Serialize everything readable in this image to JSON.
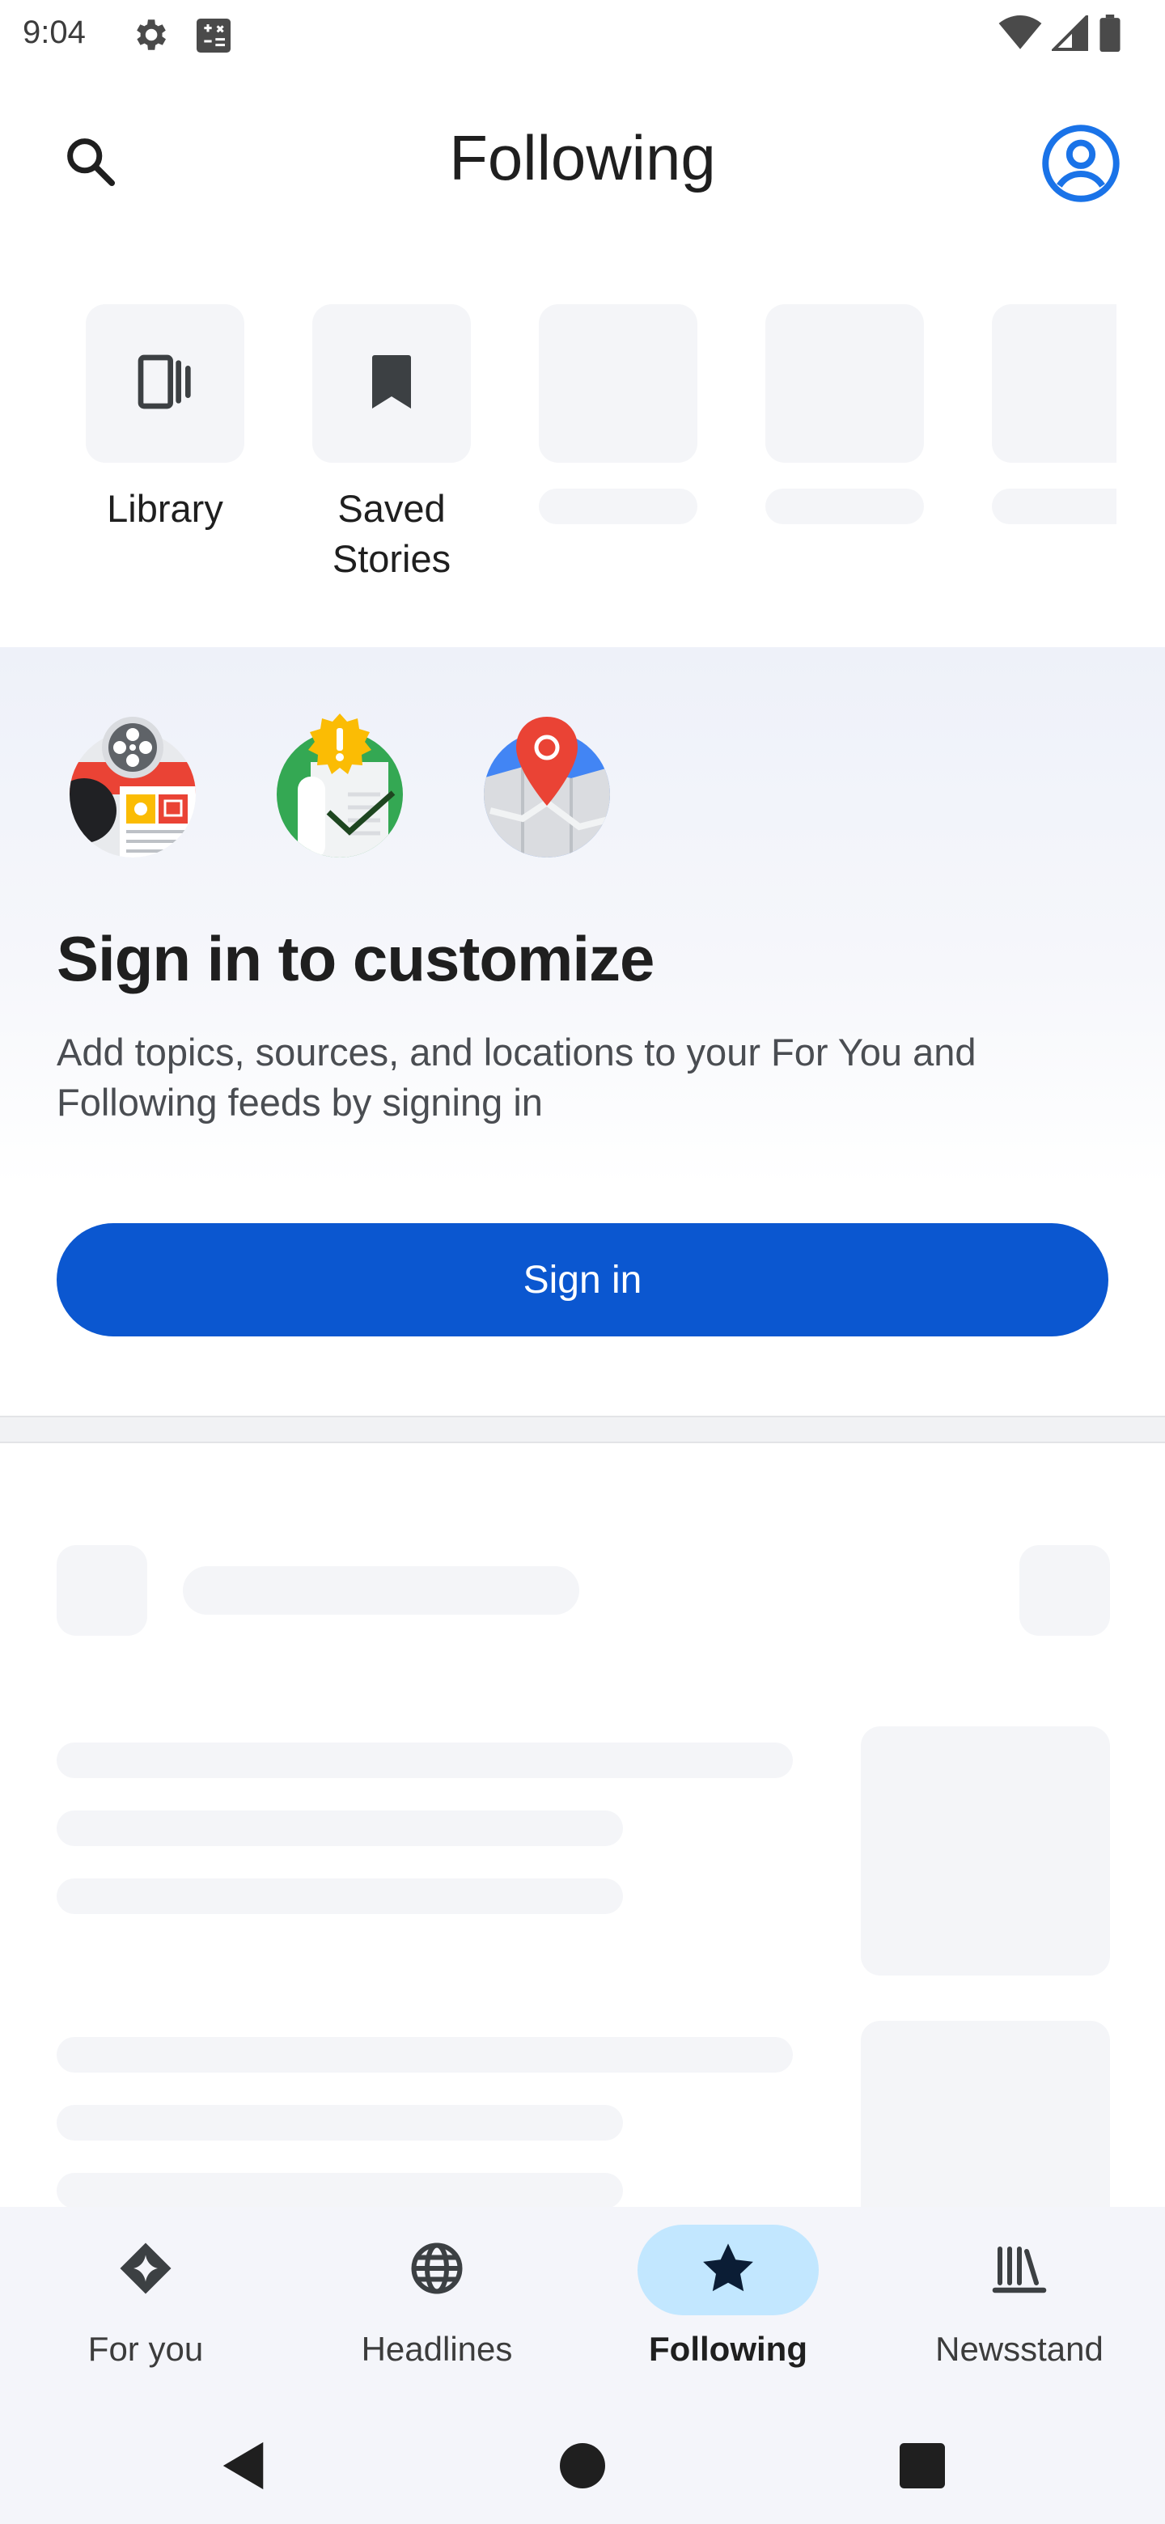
{
  "status_bar": {
    "time": "9:04",
    "icons": [
      "gear-icon",
      "clipboard-icon",
      "wifi-icon",
      "signal-icon",
      "battery-icon"
    ]
  },
  "header": {
    "title": "Following",
    "search_icon": "search-icon",
    "account_icon": "account-circle-icon"
  },
  "shortcuts": [
    {
      "label": "Library",
      "icon": "library-icon"
    },
    {
      "label": "Saved\nStories",
      "icon": "bookmark-icon"
    }
  ],
  "signin_card": {
    "title": "Sign in to customize",
    "description": "Add topics, sources, and locations to your For You and Following feeds by signing in",
    "button_label": "Sign in",
    "illustrations": [
      "entertainment-illustration",
      "news-check-illustration",
      "location-map-illustration"
    ]
  },
  "bottom_nav": {
    "items": [
      {
        "label": "For you",
        "icon": "sparkle-diamond-icon",
        "active": false
      },
      {
        "label": "Headlines",
        "icon": "globe-icon",
        "active": false
      },
      {
        "label": "Following",
        "icon": "star-icon",
        "active": true
      },
      {
        "label": "Newsstand",
        "icon": "newsstand-icon",
        "active": false
      }
    ]
  },
  "colors": {
    "accent": "#0b57d0",
    "account_icon": "#1a73e8",
    "active_nav_pill": "#c2e7ff",
    "skeleton": "#f4f5f8"
  }
}
